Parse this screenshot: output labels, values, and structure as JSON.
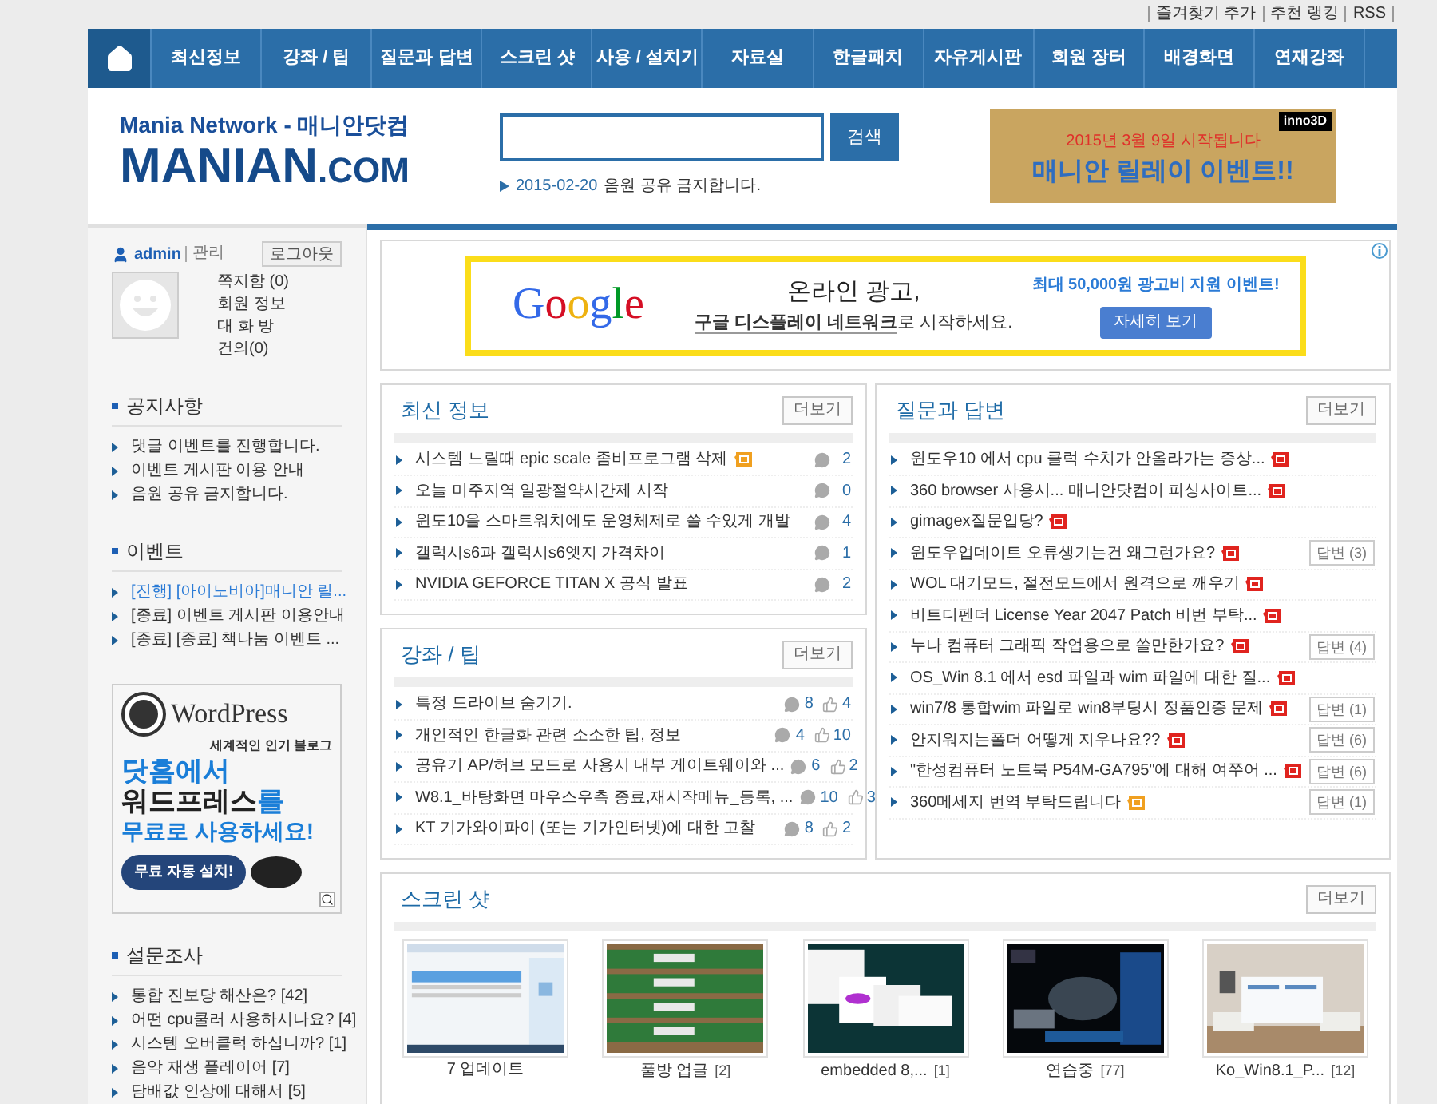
{
  "top_links": [
    "즐겨찾기 추가",
    "추천 랭킹",
    "RSS"
  ],
  "nav": [
    {
      "label": "최신정보"
    },
    {
      "label": "강좌 / 팁"
    },
    {
      "label": "질문과 답변"
    },
    {
      "label": "스크린 샷"
    },
    {
      "label": "사용 / 설치기"
    },
    {
      "label": "자료실"
    },
    {
      "label": "한글패치"
    },
    {
      "label": "자유게시판"
    },
    {
      "label": "회원 장터"
    },
    {
      "label": "배경화면"
    },
    {
      "label": "연재강좌"
    }
  ],
  "logo": {
    "tagline": "Mania Network - 매니안닷컴",
    "name": "MANIAN",
    "suffix": ".COM"
  },
  "search": {
    "button": "검색"
  },
  "ticker": {
    "date": "2015-02-20",
    "text": "음원 공유 금지합니다."
  },
  "top_banner": {
    "brand": "inno3D",
    "line1": "2015년 3월 9일 시작됩니다",
    "line2": "매니안 릴레이 이벤트!!"
  },
  "user": {
    "name": "admin",
    "role": "관리",
    "logout": "로그아웃",
    "links": [
      "쪽지함 (0)",
      "회원 정보",
      "대 화 방",
      "건의(0)"
    ]
  },
  "sidebar_sections": [
    {
      "title": "공지사항",
      "items": [
        {
          "text": "댓글 이벤트를 진행합니다.",
          "highlighted": false
        },
        {
          "text": "이벤트 게시판 이용 안내",
          "highlighted": false
        },
        {
          "text": "음원 공유 금지합니다.",
          "highlighted": false
        }
      ]
    },
    {
      "title": "이벤트",
      "items": [
        {
          "text": "[진행] [아이노비아]매니안 릴...",
          "highlighted": true
        },
        {
          "text": "[종료] 이벤트 게시판 이용안내",
          "highlighted": false
        },
        {
          "text": "[종료] [종료] 책나눔 이벤트 ...",
          "highlighted": false
        }
      ]
    }
  ],
  "wordpress_ad": {
    "brand": "WordPress",
    "subtitle": "세계적인 인기 블로그",
    "line1": "닷홈에서",
    "line2": "워드프레스",
    "line2_end": "를",
    "line3": "무료로 사용하세요!",
    "button": "무료 자동 설치!"
  },
  "survey": {
    "title": "설문조사",
    "items": [
      "통합 진보당 해산은? [42]",
      "어떤 cpu쿨러 사용하시나요? [4]",
      "시스템 오버클럭 하십니까? [1]",
      "음악 재생 플레이어 [7]",
      "담배값 인상에 대해서 [5]"
    ]
  },
  "google_ad": {
    "brand": "Google",
    "headline": "온라인 광고,",
    "link": "구글 디스플레이 네트워크",
    "rest": "로 시작하세요.",
    "promo": "최대 50,000원 광고비 지원 이벤트!",
    "button": "자세히 보기"
  },
  "latest": {
    "title": "최신 정보",
    "more": "더보기",
    "rows": [
      {
        "title": "시스템 느릴때 epic scale 좀비프로그램 삭제",
        "kind": "updated",
        "comments": "2"
      },
      {
        "title": "오늘 미주지역 일광절약시간제 시작",
        "kind": "plain",
        "comments": "0"
      },
      {
        "title": "윈도10을 스마트워치에도 운영체제로 쓸 수있게 개발",
        "kind": "plain",
        "comments": "4"
      },
      {
        "title": "갤럭시s6과 갤럭시s6엣지 가격차이",
        "kind": "plain",
        "comments": "1"
      },
      {
        "title": "NVIDIA GEFORCE TITAN X 공식 발표",
        "kind": "plain",
        "comments": "2"
      }
    ]
  },
  "lectures": {
    "title": "강좌 / 팁",
    "more": "더보기",
    "rows": [
      {
        "title": "특정 드라이브 숨기기.",
        "comments": "8",
        "likes": "4"
      },
      {
        "title": "개인적인 한글화 관련 소소한 팁, 정보",
        "comments": "4",
        "likes": "10"
      },
      {
        "title": "공유기 AP/허브 모드로 사용시 내부 게이트웨이와 ...",
        "comments": "6",
        "likes": "2"
      },
      {
        "title": "W8.1_바탕화면 마우스우측 종료,재시작메뉴_등록, ...",
        "comments": "10",
        "likes": "3"
      },
      {
        "title": "KT 기가와이파이 (또는 기가인터넷)에 대한 고찰",
        "comments": "8",
        "likes": "2"
      }
    ]
  },
  "qna": {
    "title": "질문과 답변",
    "more": "더보기",
    "rows": [
      {
        "title": "윈도우10 에서 cpu 클럭 수치가 안올라가는 증상...",
        "kind": "new"
      },
      {
        "title": "360 browser 사용시... 매니안닷컴이 피싱사이트...",
        "kind": "new"
      },
      {
        "title": "gimagex질문입당?",
        "kind": "new"
      },
      {
        "title": "윈도우업데이트 오류생기는건 왜그런가요?",
        "kind": "new",
        "answers": "답변 (3)"
      },
      {
        "title": "WOL 대기모드, 절전모드에서 원격으로 깨우기",
        "kind": "new"
      },
      {
        "title": "비트디펜더 License Year 2047 Patch 비번 부탁...",
        "kind": "new"
      },
      {
        "title": "누나 컴퓨터 그래픽 작업용으로 쓸만한가요?",
        "kind": "new",
        "answers": "답변 (4)"
      },
      {
        "title": "OS_Win 8.1 에서 esd 파일과 wim 파일에 대한 질...",
        "kind": "new"
      },
      {
        "title": "win7/8 통합wim 파일로 win8부팅시 정품인증 문제",
        "kind": "new",
        "answers": "답변 (1)"
      },
      {
        "title": "안지워지는폴더 어떻게 지우나요??",
        "kind": "new",
        "answers": "답변 (6)"
      },
      {
        "title": "\"한성컴퓨터 노트북 P54M-GA795\"에 대해 여쭈어 ...",
        "kind": "new",
        "answers": "답변 (6)"
      },
      {
        "title": "360메세지 번역 부탁드립니다",
        "kind": "updated",
        "answers": "답변 (1)"
      }
    ]
  },
  "screenshots": {
    "title": "스크린 샷",
    "more": "더보기",
    "items": [
      {
        "title": "7 업데이트",
        "kind": "picture"
      },
      {
        "title": "풀방 업글",
        "count": "[2]",
        "kind": "picture"
      },
      {
        "title": "embedded 8,...",
        "count": "[1]",
        "kind": "picture"
      },
      {
        "title": "연습중",
        "count": "[77]",
        "kind": "picture"
      },
      {
        "title": "Ko_Win8.1_P...",
        "count": "[12]",
        "kind": "picture"
      }
    ]
  }
}
